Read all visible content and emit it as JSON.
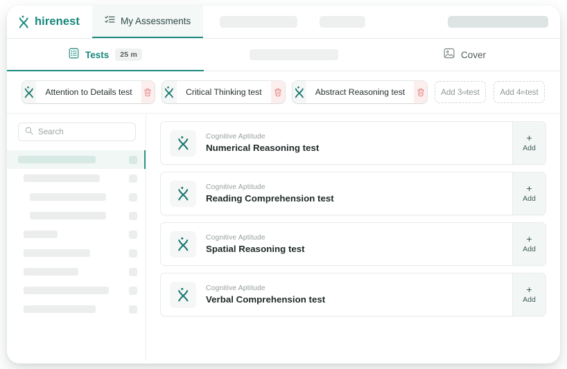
{
  "brand": {
    "name": "hirenest",
    "logo_icon": "hirenest-x-logo-icon"
  },
  "topnav": {
    "active_tab": {
      "label": "My Assessments",
      "icon": "checklist-icon"
    },
    "placeholders": [
      "placeholder-block-1",
      "placeholder-block-2",
      "placeholder-block-3"
    ]
  },
  "tabs": {
    "tests": {
      "label": "Tests",
      "badge": "25 m",
      "icon": "list-document-icon"
    },
    "middle_placeholder": "placeholder-tab",
    "cover": {
      "label": "Cover",
      "icon": "image-icon"
    }
  },
  "selected_tests": [
    {
      "name": "Attention to Details test",
      "logo_icon": "hirenest-x-logo-icon",
      "delete_icon": "trash-icon"
    },
    {
      "name": "Critical Thinking test",
      "logo_icon": "hirenest-x-logo-icon",
      "delete_icon": "trash-icon"
    },
    {
      "name": "Abstract Reasoning test",
      "logo_icon": "hirenest-x-logo-icon",
      "delete_icon": "trash-icon"
    }
  ],
  "add_slots": [
    {
      "prefix": "Add 3",
      "ordinal": "rd",
      "suffix": " test"
    },
    {
      "prefix": "Add 4",
      "ordinal": "th",
      "suffix": " test"
    }
  ],
  "sidebar": {
    "search": {
      "placeholder": "Search",
      "icon": "search-icon"
    },
    "skeleton_rows": [
      {
        "width": 112,
        "active": true
      },
      {
        "width": 110,
        "indent": 8,
        "active": false
      },
      {
        "width": 110,
        "indent": 17,
        "active": false
      },
      {
        "width": 110,
        "indent": 17,
        "active": false
      },
      {
        "width": 49,
        "indent": 8,
        "active": false
      },
      {
        "width": 96,
        "indent": 8,
        "active": false
      },
      {
        "width": 79,
        "indent": 8,
        "active": false
      },
      {
        "width": 123,
        "indent": 8,
        "active": false
      },
      {
        "width": 104,
        "indent": 8,
        "active": false
      }
    ]
  },
  "test_list": [
    {
      "category": "Cognitive Aptitude",
      "title": "Numerical Reasoning test",
      "add_label": "Add",
      "add_icon": "plus-icon",
      "logo_icon": "hirenest-x-logo-icon"
    },
    {
      "category": "Cognitive Aptitude",
      "title": "Reading Comprehension test",
      "add_label": "Add",
      "add_icon": "plus-icon",
      "logo_icon": "hirenest-x-logo-icon"
    },
    {
      "category": "Cognitive Aptitude",
      "title": "Spatial Reasoning test",
      "add_label": "Add",
      "add_icon": "plus-icon",
      "logo_icon": "hirenest-x-logo-icon"
    },
    {
      "category": "Cognitive Aptitude",
      "title": "Verbal Comprehension test",
      "add_label": "Add",
      "add_icon": "plus-icon",
      "logo_icon": "hirenest-x-logo-icon"
    }
  ],
  "colors": {
    "brand_teal": "#17887c",
    "accent_dark": "#2f968a",
    "danger_bg": "#fdeeee",
    "danger": "#e07b7b"
  }
}
